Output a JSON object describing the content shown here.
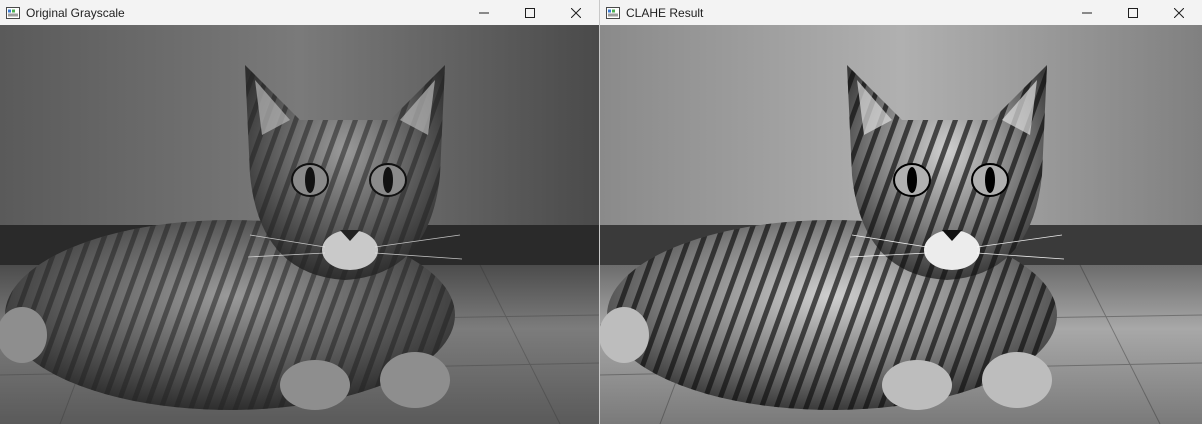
{
  "windows": [
    {
      "title": "Original Grayscale",
      "icon": "opencv-window-icon",
      "controls": [
        "minimize-icon",
        "maximize-icon",
        "close-icon"
      ],
      "image": "grayscale-cat-photo"
    },
    {
      "title": "CLAHE Result",
      "icon": "opencv-window-icon",
      "controls": [
        "minimize-icon",
        "maximize-icon",
        "close-icon"
      ],
      "image": "clahe-enhanced-cat-photo"
    }
  ],
  "colors": {
    "titlebar": "#f3f3f3",
    "title_text": "#1f1f1f",
    "icon_stroke": "#1f1f1f"
  }
}
